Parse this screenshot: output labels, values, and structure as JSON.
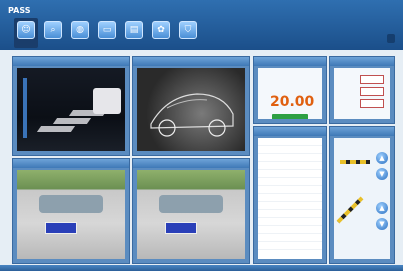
{
  "app": {
    "title": "PASS",
    "subtitle": ""
  },
  "toolbar": [
    {
      "label": "",
      "icon": "user-icon"
    },
    {
      "label": "",
      "icon": "search-icon"
    },
    {
      "label": "",
      "icon": "globe-icon"
    },
    {
      "label": "",
      "icon": "monitor-icon"
    },
    {
      "label": "",
      "icon": "document-icon"
    },
    {
      "label": "",
      "icon": "gear-icon"
    },
    {
      "label": "",
      "icon": "shield-icon"
    }
  ],
  "panels": {
    "cam1": "",
    "cam2": "",
    "cam3": "",
    "cam4": "",
    "fee": "",
    "spaces": "",
    "log": "",
    "gate": ""
  },
  "fee": {
    "price": "20.00",
    "unit": "",
    "button": ""
  },
  "plates": {
    "p1": "",
    "p2": ""
  },
  "log_rows": [
    "",
    "",
    "",
    "",
    "",
    "",
    "",
    "",
    "",
    "",
    "",
    "",
    "",
    ""
  ]
}
